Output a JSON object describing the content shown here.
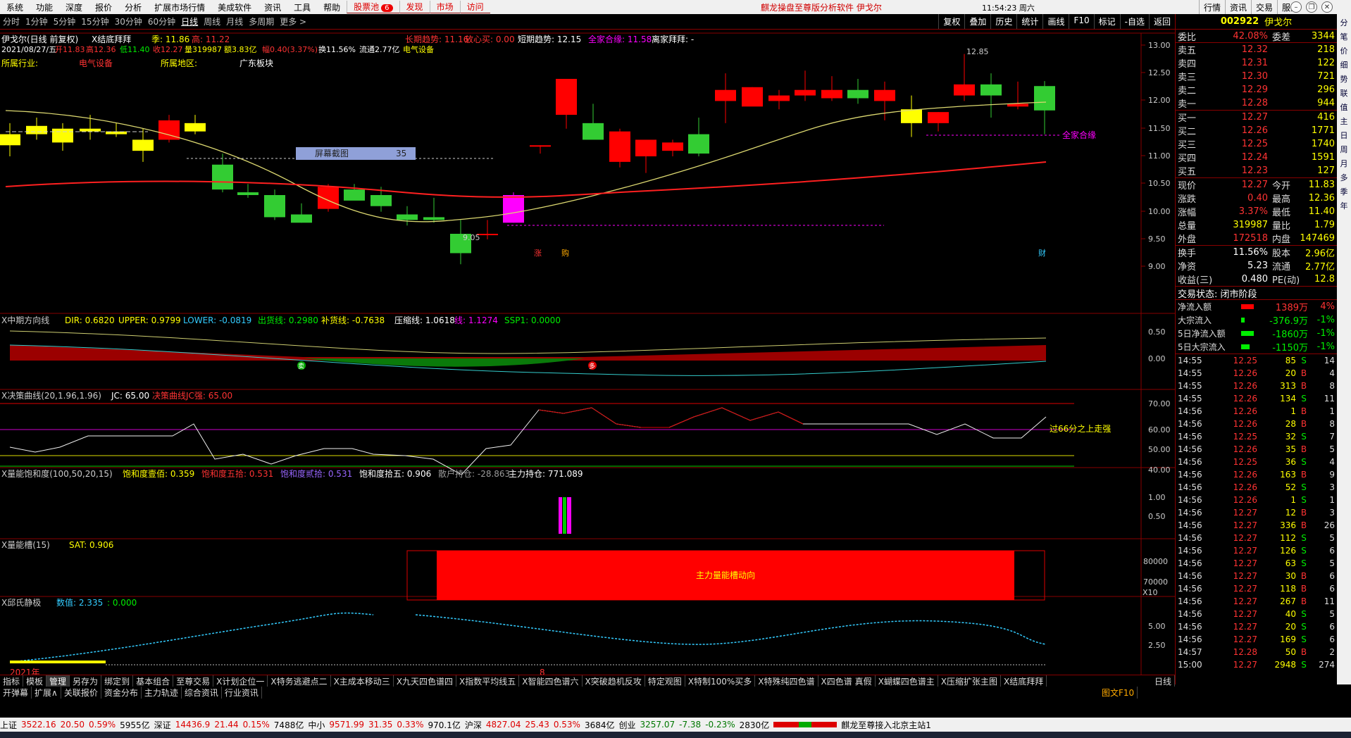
{
  "menu": {
    "items": [
      "系统",
      "功能",
      "深度",
      "报价",
      "分析",
      "扩展市场行情",
      "美成软件",
      "资讯",
      "工具",
      "帮助"
    ],
    "stock_pool": "股票池",
    "stock_pool_badge": "6",
    "extra": [
      "发现",
      "市场",
      "访问"
    ],
    "title": "麒龙操盘至尊版分析软件  伊戈尔",
    "clock": "11:54:23 周六",
    "right": [
      "行情",
      "资讯",
      "交易",
      "服务"
    ]
  },
  "period": {
    "items": [
      "分时",
      "1分钟",
      "5分钟",
      "15分钟",
      "30分钟",
      "60分钟",
      "日线",
      "周线",
      "月线",
      "多周期",
      "更多 >"
    ],
    "active_index": 6,
    "tools": [
      "复权",
      "叠加",
      "历史",
      "统计",
      "画线",
      "F10",
      "标记",
      "-自选",
      "返回"
    ]
  },
  "main": {
    "line1": {
      "name": "伊戈尔(日线 前复权)",
      "indicator": "X结底拜拜",
      "ji": "季: 11.86",
      "gao": "高: 11.22",
      "trend_long": "长期趋势: 11.16",
      "safe": "放心买: 0.00",
      "trend_short": "短期趋势: 12.15",
      "all": "全家合缘: 11.58",
      "away": "离家拜拜: -"
    },
    "line2": {
      "date": "2021/08/27/五",
      "open": "开11.83",
      "high": "高12.36",
      "low": "低11.40",
      "close": "收12.27",
      "vol": "量319987",
      "amt": "额3.83亿",
      "chg": "幅0.40(3.37%)",
      "turnover": "换11.56%",
      "float": "流通2.77亿",
      "sector": "电气设备"
    },
    "line3": {
      "industry_label": "所属行业:",
      "industry": "电气设备",
      "region_label": "所属地区:",
      "region": "广东板块"
    },
    "screenshot_label": "屏幕截图",
    "screenshot_num": "35",
    "high_mark": "12.85",
    "low_mark": "9.05",
    "all_label": "全家合缘",
    "zhang": "涨",
    "gou": "购",
    "cai": "财",
    "price_axis": [
      "13.00",
      "12.50",
      "12.00",
      "11.50",
      "11.00",
      "10.50",
      "10.00",
      "9.50",
      "9.00"
    ]
  },
  "panel2": {
    "name": "X中期方向线",
    "dir": "DIR: 0.6820",
    "upper": "UPPER: 0.9799",
    "lower": "LOWER: -0.0819",
    "out": "出货线: 0.2980",
    "add": "补货线: -0.7638",
    "press": "压缩线: 1.0618",
    "qian": "线: 1.1274",
    "ssp": "SSP1: 0.0000",
    "axis": [
      "0.50",
      "0.00"
    ],
    "mark1": "卖",
    "mark2": "多"
  },
  "panel3": {
    "name": "X决策曲线(20,1.96,1.96)",
    "jc": "JC: 65.00",
    "strong": "决策曲线JC强: 65.00",
    "note": "过66分之上走强",
    "axis": [
      "70.00",
      "60.00",
      "50.00",
      "40.00"
    ]
  },
  "panel4": {
    "name": "X量能饱和度(100,50,20,15)",
    "a": "饱和度壹佰: 0.359",
    "b": "饱和度五拾: 0.531",
    "c": "饱和度贰拾: 0.531",
    "d": "饱和度拾五: 0.906",
    "e": "散户持仓: -28.863",
    "f": "主力持仓: 771.089",
    "axis": [
      "1.00",
      "0.50"
    ]
  },
  "panel5": {
    "name": "X量能槽(15)",
    "sat": "SAT: 0.906",
    "label": "主力量能槽动向",
    "axis": [
      "80000",
      "70000"
    ],
    "x10": "X10"
  },
  "panel6": {
    "name": "X邱氏静极",
    "shu": "数值: 2.335",
    "zero": ": 0.000",
    "axis": [
      "5.00",
      "2.50"
    ],
    "year": "2021年",
    "month": "8"
  },
  "quote": {
    "code": "002922",
    "name": "伊戈尔",
    "weibi": "委比",
    "weibi_v": "42.08%",
    "weicha": "委差",
    "weicha_v": "3344",
    "asks": [
      [
        "卖五",
        "12.32",
        "218"
      ],
      [
        "卖四",
        "12.31",
        "122"
      ],
      [
        "卖三",
        "12.30",
        "721"
      ],
      [
        "卖二",
        "12.29",
        "296"
      ],
      [
        "卖一",
        "12.28",
        "944"
      ]
    ],
    "bids": [
      [
        "买一",
        "12.27",
        "416"
      ],
      [
        "买二",
        "12.26",
        "1771"
      ],
      [
        "买三",
        "12.25",
        "1740"
      ],
      [
        "买四",
        "12.24",
        "1591"
      ],
      [
        "买五",
        "12.23",
        "127"
      ]
    ],
    "stats": [
      [
        "现价",
        "12.27",
        "今开",
        "11.83"
      ],
      [
        "涨跌",
        "0.40",
        "最高",
        "12.36"
      ],
      [
        "涨幅",
        "3.37%",
        "最低",
        "11.40"
      ],
      [
        "总量",
        "319987",
        "量比",
        "1.79"
      ],
      [
        "外盘",
        "172518",
        "内盘",
        "147469"
      ]
    ],
    "stats2": [
      [
        "换手",
        "11.56%",
        "股本",
        "2.96亿"
      ],
      [
        "净资",
        "5.23",
        "流通",
        "2.77亿"
      ],
      [
        "收益(三)",
        "0.480",
        "PE(动)",
        "12.8"
      ]
    ],
    "state": "交易状态: 闭市阶段",
    "flows": [
      [
        "净流入额",
        "1389万",
        "4%"
      ],
      [
        "大宗流入",
        "-376.9万",
        "-1%"
      ],
      [
        "5日净流入额",
        "-1860万",
        "-1%"
      ],
      [
        "5日大宗流入",
        "-1150万",
        "-1%"
      ]
    ],
    "ticks": [
      [
        "14:55",
        "12.25",
        "85",
        "S",
        "14"
      ],
      [
        "14:55",
        "12.26",
        "20",
        "B",
        "4"
      ],
      [
        "14:55",
        "12.26",
        "313",
        "B",
        "8"
      ],
      [
        "14:55",
        "12.26",
        "134",
        "S",
        "11"
      ],
      [
        "14:56",
        "12.26",
        "1",
        "B",
        "1"
      ],
      [
        "14:56",
        "12.26",
        "28",
        "B",
        "8"
      ],
      [
        "14:56",
        "12.25",
        "32",
        "S",
        "7"
      ],
      [
        "14:56",
        "12.26",
        "35",
        "B",
        "5"
      ],
      [
        "14:56",
        "12.25",
        "36",
        "S",
        "4"
      ],
      [
        "14:56",
        "12.26",
        "163",
        "B",
        "9"
      ],
      [
        "14:56",
        "12.26",
        "52",
        "S",
        "3"
      ],
      [
        "14:56",
        "12.26",
        "1",
        "S",
        "1"
      ],
      [
        "14:56",
        "12.27",
        "12",
        "B",
        "3"
      ],
      [
        "14:56",
        "12.27",
        "336",
        "B",
        "26"
      ],
      [
        "14:56",
        "12.27",
        "112",
        "S",
        "5"
      ],
      [
        "14:56",
        "12.27",
        "126",
        "S",
        "6"
      ],
      [
        "14:56",
        "12.27",
        "63",
        "S",
        "5"
      ],
      [
        "14:56",
        "12.27",
        "30",
        "B",
        "6"
      ],
      [
        "14:56",
        "12.27",
        "118",
        "B",
        "6"
      ],
      [
        "14:56",
        "12.27",
        "267",
        "B",
        "11"
      ],
      [
        "14:56",
        "12.27",
        "40",
        "S",
        "5"
      ],
      [
        "14:56",
        "12.27",
        "20",
        "S",
        "6"
      ],
      [
        "14:56",
        "12.27",
        "169",
        "S",
        "6"
      ],
      [
        "14:57",
        "12.28",
        "50",
        "B",
        "2"
      ],
      [
        "15:00",
        "12.27",
        "2948",
        "S",
        "274"
      ]
    ]
  },
  "vstrip": [
    "分",
    "笔",
    "价",
    "细",
    "势",
    "联",
    "值",
    "主",
    "日",
    "周",
    "月",
    "多",
    "季",
    "年"
  ],
  "tabs1": [
    "指标",
    "模板",
    "管理",
    "另存为",
    "绑定到",
    "基本组合",
    "至尊交易",
    "X计划企位一",
    "X特务逃避点二",
    "X主成本移动三",
    "X九天四色谱四",
    "X指数平均线五",
    "X智能四色谱六",
    "X突破趋机反攻",
    "特定观图",
    "X特制100%买多",
    "X特殊纯四色谱",
    "X四色谱 真假",
    "X蝴蝶四色谱主",
    "X压缩扩张主图",
    "X结底拜拜"
  ],
  "tabs2": [
    "开弹幕",
    "扩展∧",
    "关联报价",
    "资金分布",
    "主力轨迹",
    "综合资讯",
    "行业资讯"
  ],
  "tabs1_right": "日线",
  "tabs2_right": "图文F10",
  "status": {
    "sh": "上证",
    "sh_v": "3522.16",
    "sh_c": "20.50",
    "sh_p": "0.59%",
    "sh_a": "5955亿",
    "sz": "深证",
    "sz_v": "14436.9",
    "sz_c": "21.44",
    "sz_p": "0.15%",
    "sz_a": "7488亿",
    "zx": "中小",
    "zx_v": "9571.99",
    "zx_c": "31.35",
    "zx_p": "0.33%",
    "zx_a": "970.1亿",
    "hs": "沪深",
    "hs_v": "4827.04",
    "hs_c": "25.43",
    "hs_p": "0.53%",
    "hs_a": "3684亿",
    "cy": "创业",
    "cy_v": "3257.07",
    "cy_c": "-7.38",
    "cy_p": "-0.23%",
    "cy_a": "2830亿",
    "conn": "麒龙至尊接入北京主站1"
  },
  "colors": {
    "up": "#ff0000",
    "down": "#33cc33",
    "yellow": "#ffff00",
    "magenta": "#ff00ff"
  },
  "chart_data": {
    "type": "candlestick",
    "note": "daily candles",
    "ylim": [
      8.9,
      13.1
    ],
    "candles": [
      [
        11.4,
        11.6,
        11.0,
        11.2
      ],
      [
        11.55,
        11.7,
        11.3,
        11.4
      ],
      [
        11.5,
        11.6,
        11.1,
        11.25
      ],
      [
        11.45,
        11.75,
        11.3,
        11.5
      ],
      [
        11.4,
        11.6,
        11.35,
        11.45
      ],
      [
        11.3,
        11.5,
        10.9,
        11.1
      ],
      [
        11.3,
        11.75,
        11.25,
        11.65
      ],
      [
        11.45,
        11.75,
        11.4,
        11.6
      ],
      [
        10.85,
        11.05,
        10.35,
        10.4
      ],
      [
        10.35,
        10.5,
        10.25,
        10.3
      ],
      [
        10.3,
        10.4,
        9.85,
        9.9
      ],
      [
        9.95,
        10.15,
        9.8,
        9.8
      ],
      [
        10.05,
        10.5,
        10.0,
        10.45
      ],
      [
        10.4,
        10.5,
        10.3,
        10.2
      ],
      [
        10.3,
        10.45,
        10.0,
        10.1
      ],
      [
        9.95,
        10.1,
        9.75,
        9.85
      ],
      [
        9.9,
        10.25,
        9.8,
        9.85
      ],
      [
        9.6,
        9.85,
        9.05,
        9.25
      ],
      [
        9.6,
        9.85,
        9.5,
        9.6
      ],
      [
        9.8,
        10.35,
        9.8,
        10.3
      ],
      [
        11.2,
        11.2,
        11.05,
        11.2
      ],
      [
        11.75,
        12.2,
        11.5,
        12.4
      ],
      [
        11.6,
        11.95,
        11.4,
        11.3
      ],
      [
        10.9,
        11.5,
        10.8,
        11.45
      ],
      [
        11.0,
        11.2,
        10.7,
        11.3
      ],
      [
        11.1,
        11.3,
        11.0,
        11.25
      ],
      [
        11.4,
        11.7,
        11.0,
        11.05
      ],
      [
        12.0,
        12.5,
        11.6,
        12.2
      ],
      [
        11.9,
        12.25,
        11.95,
        12.25
      ],
      [
        12.0,
        12.2,
        11.85,
        12.1
      ],
      [
        12.1,
        12.55,
        12.0,
        12.2
      ],
      [
        12.05,
        12.45,
        12.0,
        12.2
      ],
      [
        12.2,
        12.4,
        11.95,
        12.05
      ],
      [
        12.0,
        12.35,
        11.65,
        12.2
      ],
      [
        11.85,
        12.1,
        11.35,
        11.6
      ],
      [
        11.6,
        11.8,
        11.45,
        11.8
      ],
      [
        12.1,
        12.85,
        12.0,
        12.3
      ],
      [
        12.3,
        12.5,
        11.7,
        12.1
      ],
      [
        11.9,
        12.35,
        11.85,
        11.95
      ],
      [
        12.27,
        12.36,
        11.4,
        11.83
      ]
    ]
  }
}
